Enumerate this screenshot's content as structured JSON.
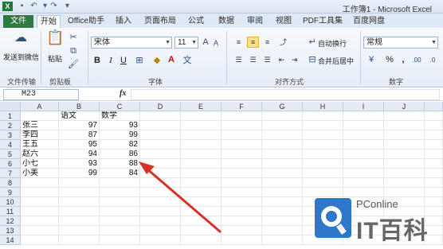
{
  "window": {
    "title": "工作簿1 - Microsoft Excel",
    "app_icon": "X",
    "quick_access": [
      "save-icon",
      "undo-icon",
      "redo-icon",
      "customize-icon"
    ]
  },
  "tabs": {
    "file": "文件",
    "start": "开始",
    "office_helper": "Office助手",
    "insert": "插入",
    "page_layout": "页面布局",
    "formulas": "公式",
    "data": "数据",
    "review": "审阅",
    "view": "视图",
    "pdf_tools": "PDF工具集",
    "baidu": "百度网盘"
  },
  "ribbon": {
    "send_to_wechat": "发送到微信",
    "file_transfer": "文件传输",
    "paste": "粘贴",
    "clipboard": "剪贴板",
    "font_name": "宋体",
    "font_size": "11",
    "font_group": "字体",
    "bold": "B",
    "italic": "I",
    "underline": "U",
    "wrap_text": "自动换行",
    "merge_center": "合并后居中",
    "alignment_group": "对齐方式",
    "number_format": "常规",
    "number_group": "数字",
    "percent": "%",
    "comma": ","
  },
  "formula_bar": {
    "name_box": "M23",
    "fx": "fx",
    "value": ""
  },
  "sheet": {
    "columns": [
      "A",
      "B",
      "C",
      "D",
      "E",
      "F",
      "G",
      "H",
      "I",
      "J"
    ],
    "rows": [
      "1",
      "2",
      "3",
      "4",
      "5",
      "6",
      "7",
      "8",
      "9",
      "10",
      "11",
      "12",
      "13",
      "14"
    ],
    "data": [
      [
        "",
        "语文",
        "数学"
      ],
      [
        "张三",
        "97",
        "93"
      ],
      [
        "李四",
        "87",
        "99"
      ],
      [
        "王五",
        "95",
        "82"
      ],
      [
        "赵六",
        "94",
        "86"
      ],
      [
        "小七",
        "93",
        "88"
      ],
      [
        "小美",
        "99",
        "84"
      ]
    ]
  },
  "watermark": {
    "brand": "PConline",
    "mark": "IT百科"
  }
}
